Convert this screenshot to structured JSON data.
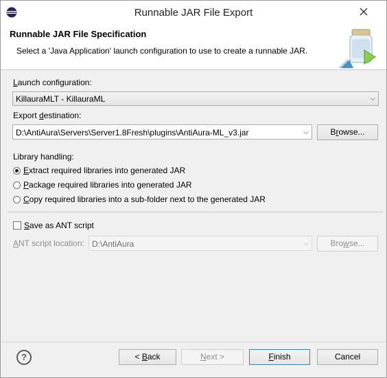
{
  "window": {
    "title": "Runnable JAR File Export"
  },
  "header": {
    "title": "Runnable JAR File Specification",
    "description": "Select a 'Java Application' launch configuration to use to create a runnable JAR."
  },
  "launch": {
    "label_pre": "",
    "label_u": "L",
    "label_post": "aunch configuration:",
    "value": "KillauraMLT - KillauraML"
  },
  "export": {
    "label_pre": "Export ",
    "label_u": "d",
    "label_post": "estination:",
    "value": "D:\\AntiAura\\Servers\\Server1.8Fresh\\plugins\\AntiAura-ML_v3.jar",
    "browse_pre": "B",
    "browse_u": "r",
    "browse_post": "owse..."
  },
  "library": {
    "label": "Library handling:",
    "options": [
      {
        "pre": "",
        "u": "E",
        "post": "xtract required libraries into generated JAR",
        "selected": true
      },
      {
        "pre": "",
        "u": "P",
        "post": "ackage required libraries into generated JAR",
        "selected": false
      },
      {
        "pre": "",
        "u": "C",
        "post": "opy required libraries into a sub-folder next to the generated JAR",
        "selected": false
      }
    ]
  },
  "ant": {
    "checkbox_pre": "",
    "checkbox_u": "S",
    "checkbox_post": "ave as ANT script",
    "checked": false,
    "location_label_pre": "",
    "location_label_u": "A",
    "location_label_post": "NT script location:",
    "location_value": "D:\\AntiAura",
    "browse_pre": "Bro",
    "browse_u": "w",
    "browse_post": "se..."
  },
  "buttons": {
    "back_pre": "< ",
    "back_u": "B",
    "back_post": "ack",
    "next_pre": "",
    "next_u": "N",
    "next_post": "ext >",
    "finish_pre": "",
    "finish_u": "F",
    "finish_post": "inish",
    "cancel": "Cancel"
  },
  "icons": {
    "app": "eclipse-icon",
    "close": "close-icon",
    "header": "jar-wizard-icon",
    "help": "help-icon"
  }
}
